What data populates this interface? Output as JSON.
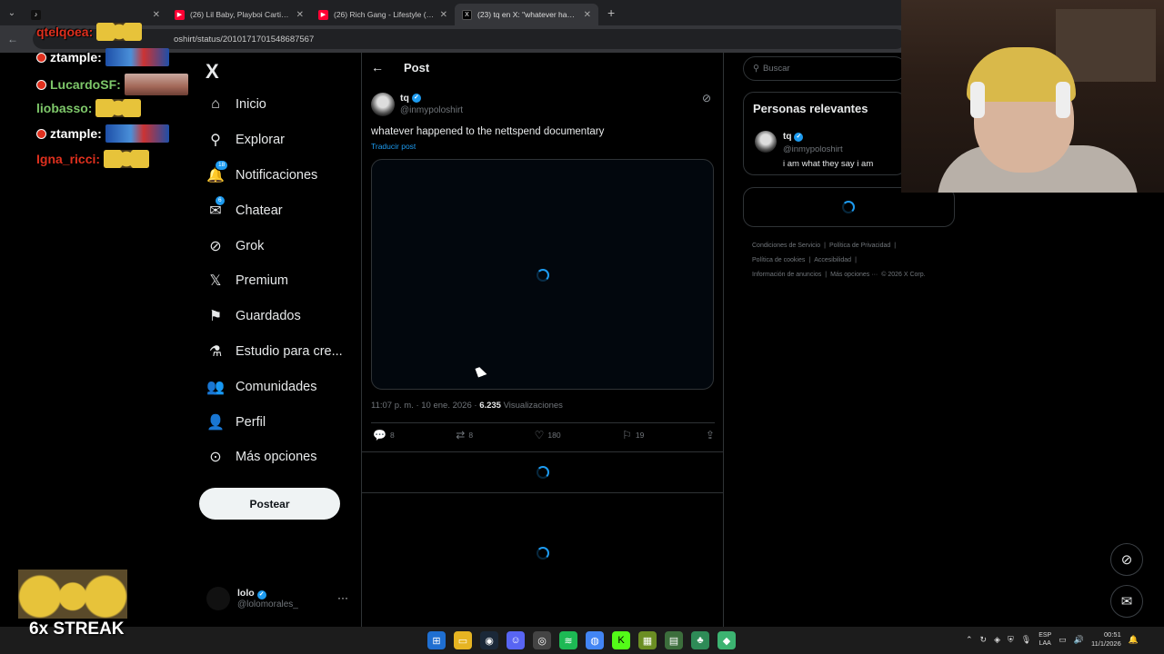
{
  "browser": {
    "tabs": [
      {
        "label": "",
        "favicon": "tiktok-icon"
      },
      {
        "label": "(26) Lil Baby, Playboi Carti, & St",
        "favicon": "youtube-icon"
      },
      {
        "label": "(26) Rich Gang - Lifestyle (Offici",
        "favicon": "youtube-icon"
      },
      {
        "label": "(23) tq en X: \"whatever happene",
        "favicon": "x-icon"
      }
    ],
    "url": "oshirt/status/2010171701548687567"
  },
  "chat": [
    {
      "user": "qtelqoea:",
      "color": "#e0301e",
      "badge": false,
      "emote": "minion"
    },
    {
      "user": "ztample:",
      "color": "#ffffff",
      "badge": true,
      "emote": "car"
    },
    {
      "user": "LucardoSF:",
      "color": "#7ec86a",
      "badge": true,
      "emote": "grandma"
    },
    {
      "user": "liobasso:",
      "color": "#7ec86a",
      "badge": false,
      "emote": "minion"
    },
    {
      "user": "ztample:",
      "color": "#ffffff",
      "badge": true,
      "emote": "car"
    },
    {
      "user": "Igna_ricci:",
      "color": "#e0301e",
      "badge": false,
      "emote": "minion"
    }
  ],
  "nav": {
    "logo": "X",
    "items": [
      {
        "label": "Inicio",
        "icon": "home-icon",
        "glyph": "⌂"
      },
      {
        "label": "Explorar",
        "icon": "search-icon",
        "glyph": "⚲"
      },
      {
        "label": "Notificaciones",
        "icon": "bell-icon",
        "glyph": "🔔",
        "badge": "18"
      },
      {
        "label": "Chatear",
        "icon": "mail-icon",
        "glyph": "✉",
        "badge": "6"
      },
      {
        "label": "Grok",
        "icon": "grok-icon",
        "glyph": "⊘"
      },
      {
        "label": "Premium",
        "icon": "x-premium-icon",
        "glyph": "𝕏"
      },
      {
        "label": "Guardados",
        "icon": "bookmark-icon",
        "glyph": "⚑"
      },
      {
        "label": "Estudio para cre...",
        "icon": "flask-icon",
        "glyph": "⚗"
      },
      {
        "label": "Comunidades",
        "icon": "people-icon",
        "glyph": "👥"
      },
      {
        "label": "Perfil",
        "icon": "person-icon",
        "glyph": "👤"
      },
      {
        "label": "Más opciones",
        "icon": "more-circle-icon",
        "glyph": "⊙"
      }
    ],
    "post_button": "Postear",
    "account": {
      "name": "lolo",
      "handle": "@lolomorales_",
      "more": "···"
    }
  },
  "post": {
    "header": "Post",
    "author": {
      "name": "tq",
      "handle": "@inmypoloshirt"
    },
    "text": "whatever happened to the nettspend documentary",
    "translate": "Traducir post",
    "time": "11:07 p. m. · 10 ene. 2026 · ",
    "views_count": "6.235",
    "views_label": " Visualizaciones",
    "replies": "8",
    "reposts": "8",
    "likes": "180",
    "bookmarks": "19"
  },
  "right": {
    "search_placeholder": "Buscar",
    "relevant_title": "Personas relevantes",
    "relevant_person": {
      "name": "tq",
      "handle": "@inmypoloshirt",
      "bio": "i am what they say i am"
    },
    "footer": [
      "Condiciones de Servicio",
      "|",
      "Política de Privacidad",
      "|",
      "Política de cookies",
      "|",
      "Accesibilidad",
      "|",
      "Información de anuncios",
      "|",
      "Más opciones ···",
      "© 2026 X Corp."
    ]
  },
  "overlay": {
    "streak": "6x STREAK"
  },
  "taskbar": {
    "lang_top": "ESP",
    "lang_bottom": "LAA",
    "time": "00:51",
    "date": "11/1/2026"
  },
  "colors": {
    "accent": "#1d9bf0",
    "background": "#000000",
    "border": "#2f3336",
    "muted": "#71767b"
  }
}
